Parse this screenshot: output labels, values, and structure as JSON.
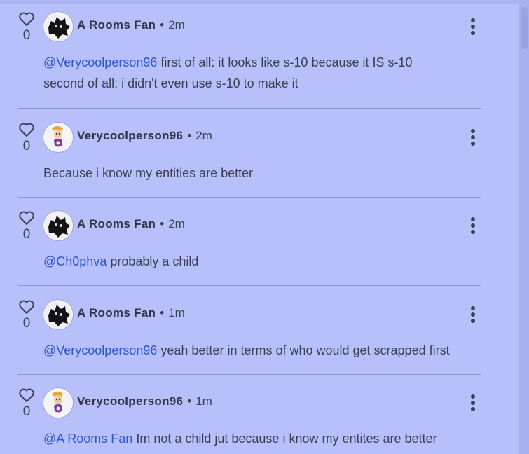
{
  "comments": [
    {
      "like_count": "0",
      "author": "A Rooms Fan",
      "separator": "•",
      "time": "2m",
      "avatar": "dark-avatar",
      "mention": "@Verycoolperson96",
      "text": " first of all: it looks like s-10 because it IS s-10",
      "text2": "second of all: i didn't even use s-10 to make it"
    },
    {
      "like_count": "0",
      "author": "Verycoolperson96",
      "separator": "•",
      "time": "2m",
      "avatar": "rayman-avatar",
      "mention": "",
      "text": "Because i know my entities are better",
      "text2": ""
    },
    {
      "like_count": "0",
      "author": "A Rooms Fan",
      "separator": "•",
      "time": "2m",
      "avatar": "dark-avatar",
      "mention": "@Ch0phva",
      "text": " probably a child",
      "text2": ""
    },
    {
      "like_count": "0",
      "author": "A Rooms Fan",
      "separator": "•",
      "time": "1m",
      "avatar": "dark-avatar",
      "mention": "@Verycoolperson96",
      "text": " yeah better in terms of who would get scrapped first",
      "text2": ""
    },
    {
      "like_count": "0",
      "author": "Verycoolperson96",
      "separator": "•",
      "time": "1m",
      "avatar": "rayman-avatar",
      "mention": "@A Rooms Fan",
      "text": " Im not a child jut because i know my entites are better",
      "text2": ""
    }
  ],
  "colors": {
    "background": "#b8c0fb",
    "mention": "#2f57c9",
    "divider": "#8f96c9"
  }
}
